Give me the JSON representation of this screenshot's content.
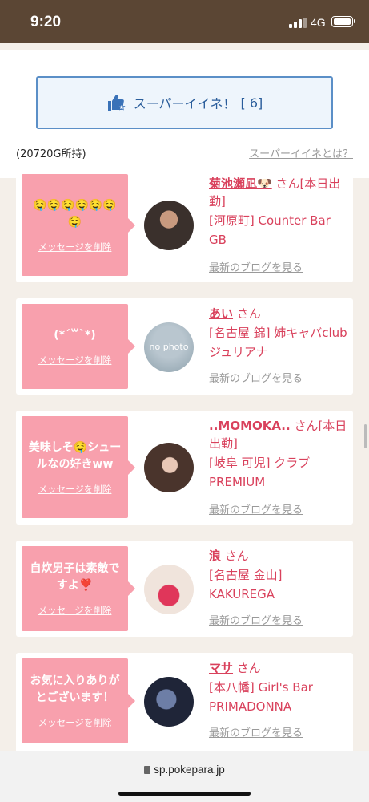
{
  "status_bar": {
    "time": "9:20",
    "network": "4G"
  },
  "super_like": {
    "label": "スーパーイイネ！",
    "count": "[ 6]"
  },
  "holding": "(20720G所持)",
  "about_link": "スーパーイイネとは？",
  "cards": [
    {
      "message": "🤤🤤🤤🤤🤤🤤🤤",
      "delete_label": "メッセージを削除",
      "name": "菊池瀬凪🐶",
      "name_suffix": " さん[本日出勤]",
      "shop": "[河原町] Counter Bar GB",
      "blog_link": "最新のブログを見る"
    },
    {
      "message": "(*´꒳`*)",
      "delete_label": "メッセージを削除",
      "avatar_text": "no photo",
      "name": "あい",
      "name_suffix": " さん",
      "shop": "[名古屋 錦] 姉キャバclub ジュリアナ",
      "blog_link": "最新のブログを見る"
    },
    {
      "message": "美味しそ🤤シュールなの好きww",
      "delete_label": "メッセージを削除",
      "name": "..MOMOKA..",
      "name_suffix": " さん[本日出勤]",
      "shop": "[岐阜 可児] クラブPREMIUM",
      "blog_link": "最新のブログを見る"
    },
    {
      "message": "自炊男子は素敵ですよ❣️",
      "delete_label": "メッセージを削除",
      "name": "浪",
      "name_suffix": " さん",
      "shop": "[名古屋 金山] KAKUREGA",
      "blog_link": "最新のブログを見る"
    },
    {
      "message": "お気に入りありがとございます！",
      "delete_label": "メッセージを削除",
      "name": "マサ",
      "name_suffix": " さん",
      "shop": "[本八幡] Girl's Bar PRIMADONNA",
      "blog_link": "最新のブログを見る"
    }
  ],
  "browser": {
    "url": "sp.pokepara.jp"
  }
}
